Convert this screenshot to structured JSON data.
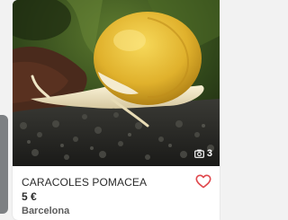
{
  "listing": {
    "title": "CARACOLES POMACEA",
    "price": "5 €",
    "location": "Barcelona",
    "photo_count": "3",
    "photo_subject": "yellow apple snail on dark aquarium gravel",
    "icons": {
      "favorite": "heart-outline-icon",
      "photos": "camera-icon"
    },
    "colors": {
      "favorite_accent": "#e0484d"
    }
  }
}
